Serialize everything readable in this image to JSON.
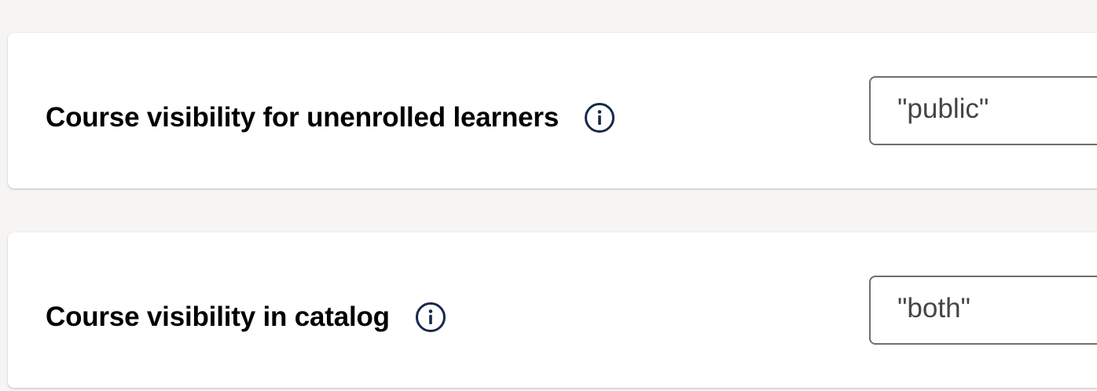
{
  "settings": [
    {
      "label": "Course visibility for unenrolled learners",
      "value": "\"public\"",
      "info_icon": "info-circle-icon"
    },
    {
      "label": "Course visibility in catalog",
      "value": "\"both\"",
      "info_icon": "info-circle-icon"
    }
  ],
  "colors": {
    "page_background": "#f6f5f3",
    "card_background": "#ffffff",
    "label_text": "#000000",
    "icon_color": "#15294a",
    "input_border": "#6f6f6f",
    "input_text": "#454545"
  }
}
